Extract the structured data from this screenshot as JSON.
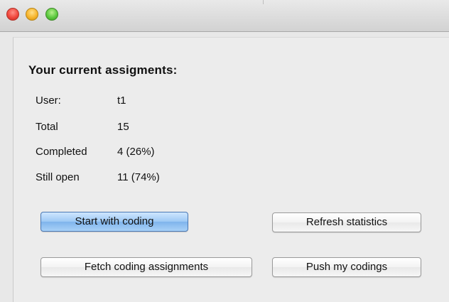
{
  "window": {
    "title": ""
  },
  "heading": "Your current assigments:",
  "stats": {
    "user": {
      "label": "User:",
      "value": "t1"
    },
    "total": {
      "label": "Total",
      "value": "15"
    },
    "completed": {
      "label": "Completed",
      "value": "4 (26%)"
    },
    "still_open": {
      "label": "Still open",
      "value": "11 (74%)"
    }
  },
  "buttons": {
    "start_coding": "Start with coding",
    "refresh_statistics": "Refresh statistics",
    "fetch_assignments": "Fetch coding assignments",
    "push_codings": "Push my codings"
  },
  "colors": {
    "default_button": "#9cc8f4",
    "window_background": "#ececec",
    "close_button": "#f0483d",
    "minimize_button": "#f7b52c",
    "zoom_button": "#5cc93f"
  }
}
